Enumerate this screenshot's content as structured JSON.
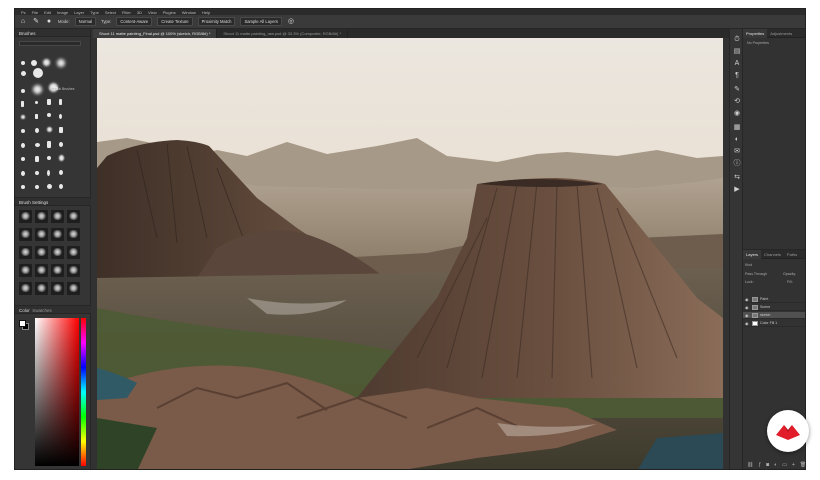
{
  "menubar": {
    "items": [
      "Ps",
      "File",
      "Edit",
      "Image",
      "Layer",
      "Type",
      "Select",
      "Filter",
      "3D",
      "View",
      "Plugins",
      "Window",
      "Help"
    ]
  },
  "options_bar": {
    "mode_label": "Mode:",
    "mode_value": "Normal",
    "type_label": "Type:",
    "content_aware": "Content-Aware",
    "create_texture": "Create Texture",
    "proximity_match": "Proximity Match",
    "sample_all_layers": "Sample All Layers"
  },
  "left_panel": {
    "brushes_title": "Brushes",
    "brush_group_label": "General Brushes",
    "brush_settings_title": "Brush Settings",
    "color_title": "Color",
    "swatches_title": "Swatches"
  },
  "document_tabs": [
    {
      "label": "Shoot 11 matte painting_Final.psd @ 100% (sketch, RGB/8#) *",
      "active": true
    },
    {
      "label": "Shoot 11 matte painting_raw.psd @ 33.3% (Composite, RGB/8#) *",
      "active": false
    }
  ],
  "properties_panel": {
    "tabs": [
      "Properties",
      "Adjustments"
    ],
    "no_properties": "No Properties"
  },
  "layers_panel": {
    "tabs": [
      "Layers",
      "Channels",
      "Paths"
    ],
    "kind_label": "Kind",
    "blend_mode": "Pass Through",
    "opacity_label": "Opacity:",
    "fill_label": "Fill:",
    "lock_label": "Lock:",
    "layers": [
      {
        "name": "Paint",
        "selected": false
      },
      {
        "name": "Scene",
        "selected": false
      },
      {
        "name": "sketch",
        "selected": true
      },
      {
        "name": "Color Fill 1",
        "selected": false
      }
    ]
  },
  "colors": {
    "app_bg": "#323232",
    "accent_logo": "#e11d2b",
    "selected_layer": "#505050"
  }
}
